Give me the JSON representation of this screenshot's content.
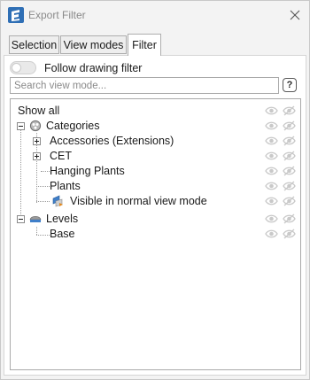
{
  "window": {
    "title": "Export Filter"
  },
  "tabs": [
    {
      "label": "Selection",
      "active": false
    },
    {
      "label": "View modes",
      "active": false
    },
    {
      "label": "Filter",
      "active": true
    }
  ],
  "filter": {
    "follow_toggle_label": "Follow drawing filter",
    "follow_toggle_on": false,
    "search_placeholder": "Search view mode...",
    "search_value": "",
    "help_label": "?"
  },
  "tree": {
    "show_all": "Show all",
    "categories": {
      "label": "Categories",
      "children": [
        {
          "label": "Accessories (Extensions)",
          "expandable": true
        },
        {
          "label": "CET",
          "expandable": true
        },
        {
          "label": "Hanging Plants",
          "expandable": false
        },
        {
          "label": "Plants",
          "expandable": false
        },
        {
          "label": "Visible in normal view mode",
          "expandable": false
        }
      ]
    },
    "levels": {
      "label": "Levels",
      "children": [
        {
          "label": "Base"
        }
      ]
    }
  },
  "icons": {
    "app": "app-logo-icon",
    "close": "close-icon",
    "visible": "eye-icon",
    "hidden": "eye-off-icon",
    "categories": "categories-icon",
    "levels": "levels-icon",
    "view_mode": "view-mode-icon"
  },
  "colors": {
    "app_icon": "#2f6fb5",
    "muted_icon": "#c9c9c9"
  }
}
